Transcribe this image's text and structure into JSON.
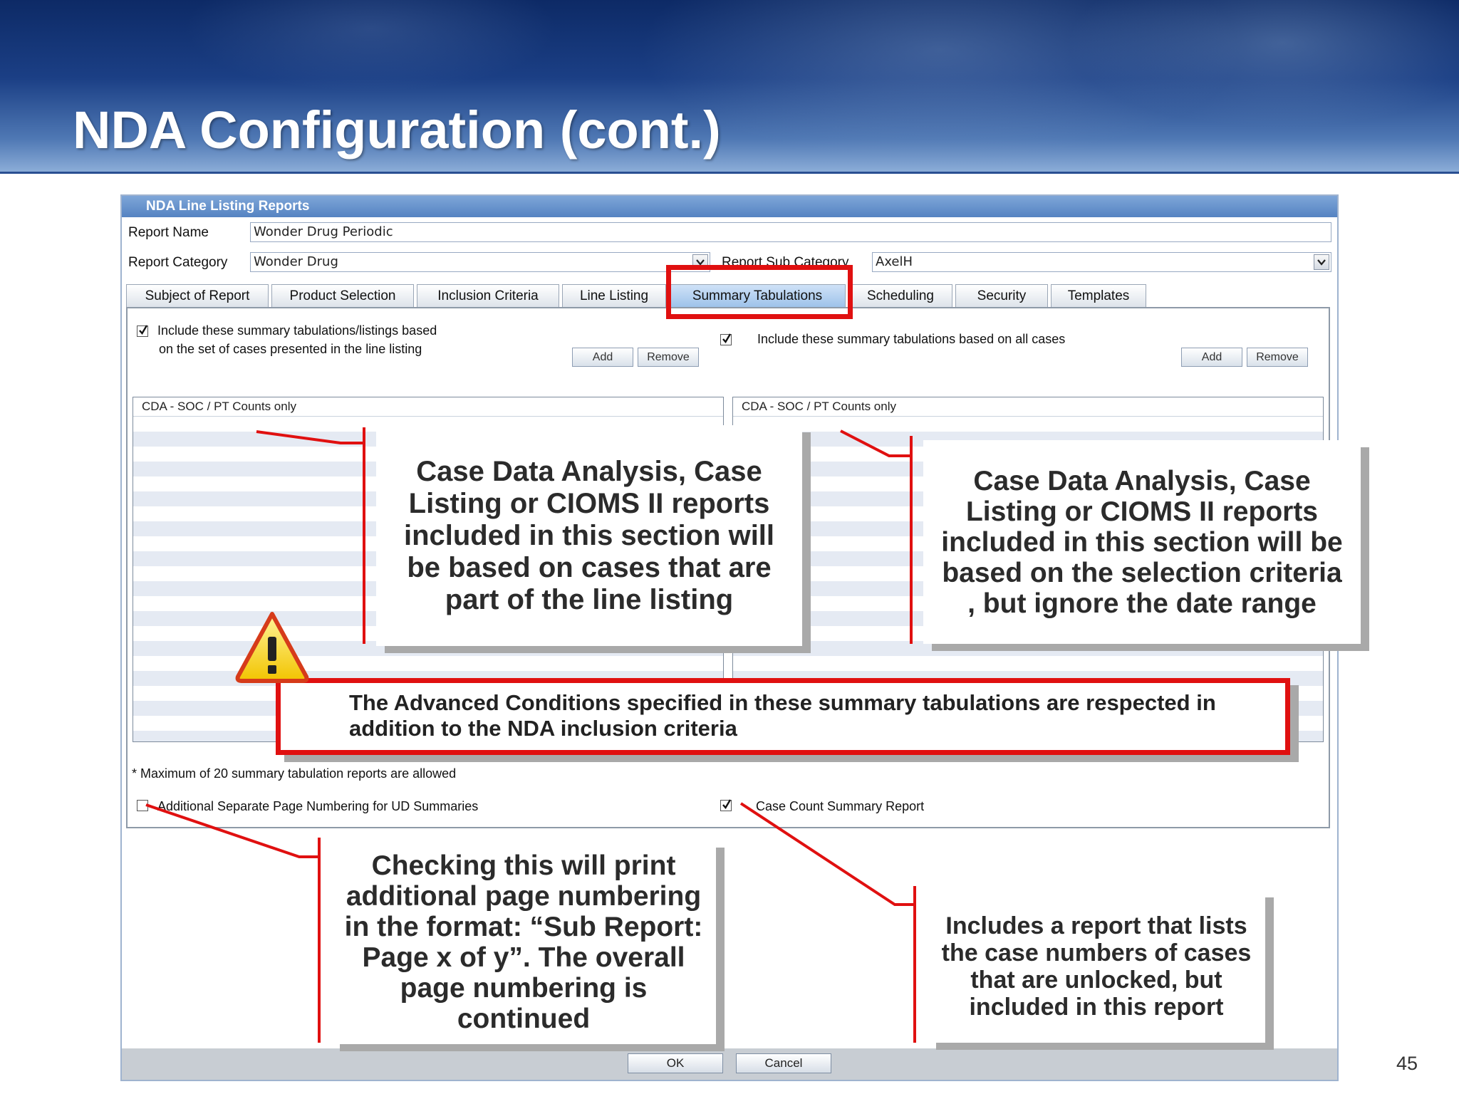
{
  "slide": {
    "title": "NDA Configuration (cont.)",
    "page_number": "45"
  },
  "window": {
    "title": "NDA Line Listing Reports",
    "report_name_label": "Report Name",
    "report_name_value": "Wonder Drug Periodic",
    "report_category_label": "Report Category",
    "report_category_value": "Wonder Drug",
    "report_sub_category_label": "Report Sub Category",
    "report_sub_category_value": "AxelH"
  },
  "tabs": [
    {
      "label": "Subject of Report"
    },
    {
      "label": "Product Selection"
    },
    {
      "label": "Inclusion Criteria"
    },
    {
      "label": "Line Listing"
    },
    {
      "label": "Summary Tabulations",
      "active": true
    },
    {
      "label": "Scheduling"
    },
    {
      "label": "Security"
    },
    {
      "label": "Templates"
    }
  ],
  "panel": {
    "left_checkbox_checked": true,
    "left_checkbox_line1": "Include these summary tabulations/listings based",
    "left_checkbox_line2": "on the set of cases presented in the line listing",
    "right_checkbox_checked": true,
    "right_checkbox_label": "Include these summary tabulations based on all cases",
    "add_label": "Add",
    "remove_label": "Remove",
    "left_list_item": "CDA - SOC / PT Counts only",
    "right_list_item": "CDA - SOC / PT Counts only",
    "max_note": "* Maximum of 20 summary tabulation reports are allowed",
    "separate_numbering_checked": false,
    "separate_numbering_label": "Additional Separate Page Numbering for UD Summaries",
    "case_count_checked": true,
    "case_count_label": "Case Count Summary Report"
  },
  "buttons": {
    "ok": "OK",
    "cancel": "Cancel"
  },
  "callouts": {
    "left_top": "Case Data Analysis, Case Listing or CIOMS II reports included in this section will be based on cases that are part of the line listing",
    "right_top": "Case Data Analysis, Case Listing or CIOMS II reports included in this section will be based on the selection criteria , but ignore the date range",
    "advanced_note_line1": "The Advanced Conditions specified in these summary tabulations are respected in",
    "advanced_note_line2": "addition to the NDA inclusion criteria",
    "bottom_left": "Checking this will print additional page numbering in the format: “Sub Report: Page x of y”.  The overall page numbering is continued",
    "bottom_right": "Includes a report that lists the case numbers of cases that are unlocked, but included in this report"
  },
  "colors": {
    "highlight_red": "#e01010",
    "window_title_blue": "#5583c2",
    "header_dark_blue": "#0d2a66"
  },
  "icons": {
    "warning": "warning-icon",
    "checkmark": "checkmark-icon",
    "dropdown": "chevron-down-icon"
  }
}
